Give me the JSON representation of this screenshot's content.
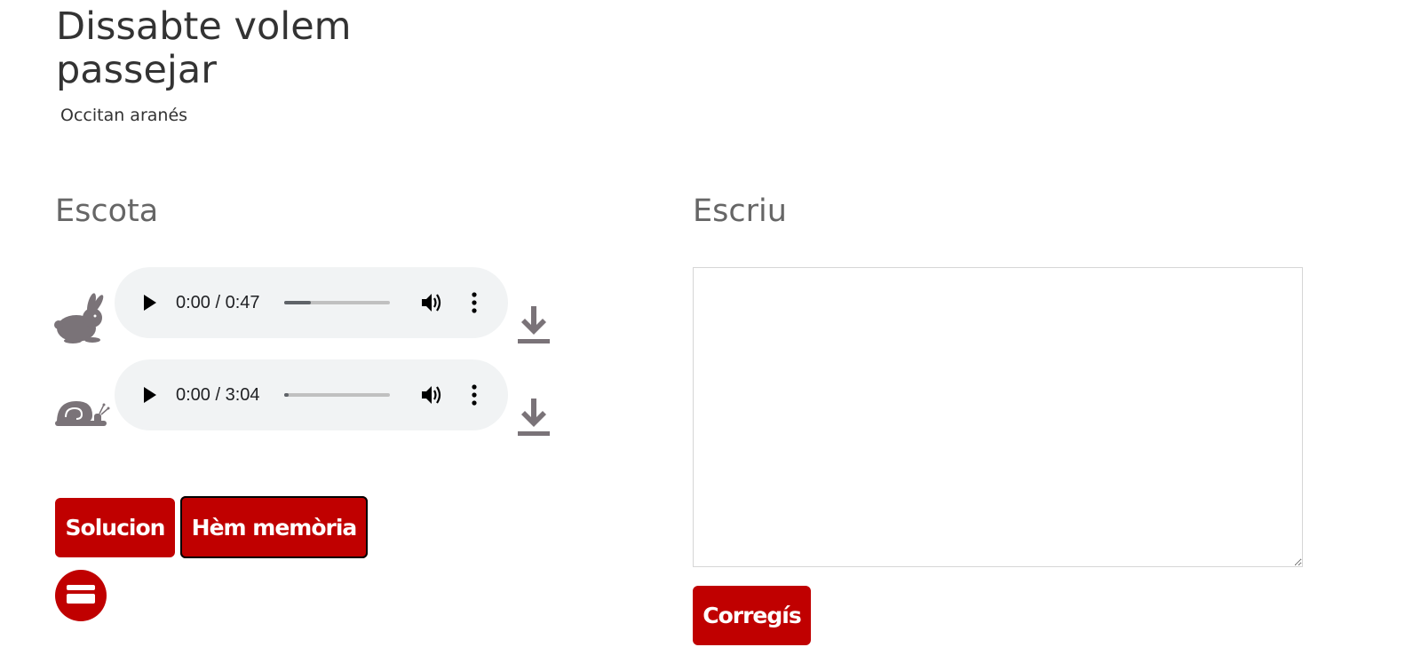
{
  "header": {
    "title": "Dissabte volem passejar",
    "language": "Occitan aranés"
  },
  "listen": {
    "heading": "Escota",
    "players": [
      {
        "speed_icon": "rabbit-icon",
        "time": "0:00 / 0:47",
        "progress_fraction": 0.25
      },
      {
        "speed_icon": "snail-icon",
        "time": "0:00 / 3:04",
        "progress_fraction": 0.04
      }
    ],
    "buttons": {
      "solution_label": "Solucion",
      "memory_label": "Hèm memòria"
    },
    "print_icon": "printer-icon"
  },
  "write": {
    "heading": "Escriu",
    "answer_value": "",
    "correct_label": "Corregís"
  },
  "colors": {
    "accent": "#c00000",
    "icon_gray": "#7a7378",
    "player_bg": "#f1f3f4"
  }
}
